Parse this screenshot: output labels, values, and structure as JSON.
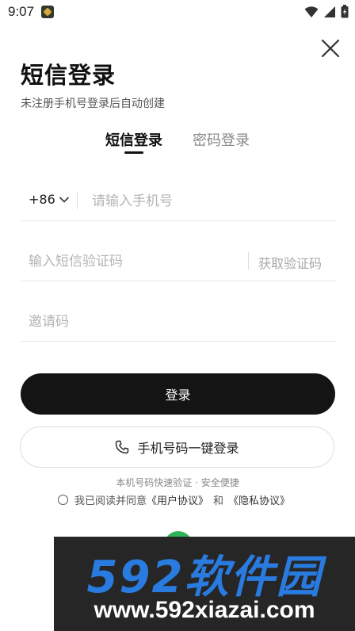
{
  "status_bar": {
    "time": "9:07"
  },
  "header": {
    "title": "短信登录",
    "subtitle": "未注册手机号登录后自动创建"
  },
  "tabs": [
    {
      "label": "短信登录",
      "active": true
    },
    {
      "label": "密码登录",
      "active": false
    }
  ],
  "form": {
    "country_code": "+86",
    "phone_placeholder": "请输入手机号",
    "code_placeholder": "输入短信验证码",
    "get_code_label": "获取验证码",
    "invite_placeholder": "邀请码"
  },
  "buttons": {
    "login_label": "登录",
    "onekey_label": "手机号码一键登录"
  },
  "footer": {
    "hint": "本机号码快速验证 · 安全便捷",
    "agree_prefix": "我已阅读并同意",
    "user_agreement": "《用户协议》",
    "and": "和",
    "privacy_agreement": "《隐私协议》"
  },
  "watermark": {
    "brand": "592软件园",
    "url": "www.592xiazai.com"
  },
  "colors": {
    "primary_button": "#141414",
    "accent_green": "#2fb45a",
    "watermark_blue": "#2a7be0"
  }
}
